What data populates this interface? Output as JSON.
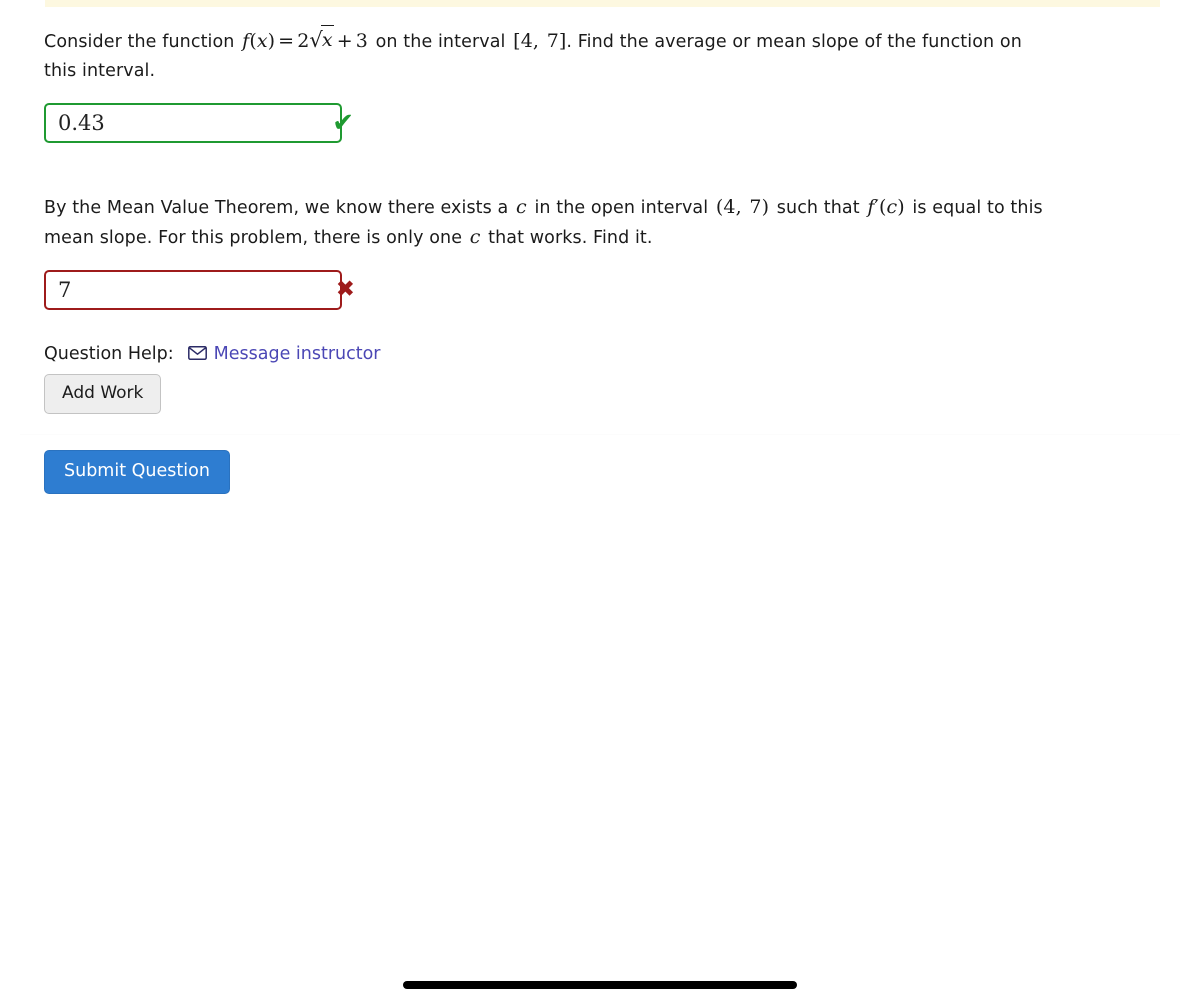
{
  "colors": {
    "correct": "#1f9a31",
    "incorrect": "#9e1b1b",
    "link": "#4b47b5",
    "submit_button": "#2e7dd1",
    "top_strip": "#fdf8e0",
    "add_work_button": "#eeeeee"
  },
  "problem": {
    "part1": {
      "text_before_fn": "Consider the function",
      "fn_name": "f",
      "fn_var": "x",
      "equals": "=",
      "coefficient": "2",
      "radicand": "x",
      "plus": "+",
      "constant": "3",
      "text_mid": "on the interval",
      "interval_open_bracket": "[",
      "interval_left": "4",
      "interval_comma": ",",
      "interval_right": "7",
      "interval_close_bracket": "]",
      "text_after": ". Find the average or mean slope of the function on this interval."
    },
    "part2": {
      "text_1": "By the Mean Value Theorem, we know there exists a",
      "var_c": "c",
      "text_2": "in the open interval",
      "open_paren": "(",
      "interval_left": "4",
      "interval_comma": ",",
      "interval_right": "7",
      "close_paren": ")",
      "text_3": "such that",
      "deriv_f": "f",
      "deriv_prime": "′",
      "deriv_open": "(",
      "deriv_c": "c",
      "deriv_close": ")",
      "text_4": "is equal to this mean slope. For this problem, there is only one",
      "var_c2": "c",
      "text_5": "that works. Find it."
    }
  },
  "answers": {
    "first": {
      "value": "0.43",
      "status": "correct",
      "mark_glyph": "✔",
      "mark_name": "correct-checkmark"
    },
    "second": {
      "value": "7",
      "status": "incorrect",
      "mark_glyph": "✖",
      "mark_name": "incorrect-cross"
    }
  },
  "help": {
    "label": "Question Help:",
    "message_instructor_label": "Message instructor",
    "envelope_glyph": "✉",
    "add_work_label": "Add Work"
  },
  "actions": {
    "submit_label": "Submit Question"
  }
}
